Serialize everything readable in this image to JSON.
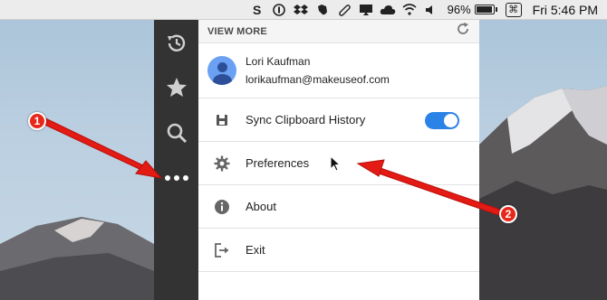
{
  "menubar": {
    "icons": [
      "scribd-icon",
      "1password-icon",
      "dropbox-icon",
      "evernote-icon",
      "paperclip-icon",
      "airplay-icon",
      "icloud-icon",
      "wifi-icon",
      "volume-icon"
    ],
    "battery_percent": "96%",
    "battery_level": 0.96,
    "keyboard_icon": "command-key-icon",
    "time": "Fri 5:46 PM"
  },
  "sidebar": {
    "items": [
      {
        "name": "history",
        "icon": "history-icon"
      },
      {
        "name": "favorites",
        "icon": "star-icon"
      },
      {
        "name": "search",
        "icon": "search-icon"
      },
      {
        "name": "more",
        "icon": "more-dots-icon",
        "active": true
      }
    ]
  },
  "panel": {
    "header": "VIEW MORE",
    "user": {
      "name": "Lori Kaufman",
      "email": "lorikaufman@makeuseof.com"
    },
    "menu": [
      {
        "label": "Sync Clipboard History",
        "icon": "clipboard-icon",
        "toggle": true
      },
      {
        "label": "Preferences",
        "icon": "gear-icon"
      },
      {
        "label": "About",
        "icon": "info-icon"
      },
      {
        "label": "Exit",
        "icon": "exit-icon"
      }
    ]
  },
  "annotations": [
    "1",
    "2"
  ],
  "colors": {
    "sidebar_bg": "#333333",
    "toggle_on": "#2b83e8",
    "callout": "#e8271b",
    "avatar": "#6aa1f2"
  }
}
